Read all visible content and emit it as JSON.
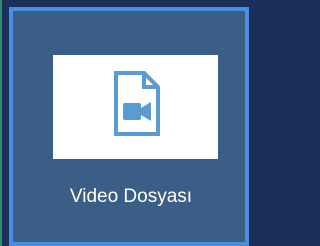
{
  "tile": {
    "label": "Video Dosyası",
    "icon": "video-file-icon"
  },
  "colors": {
    "background": "#1b2f5a",
    "tile": "#3b5e86",
    "tile_border": "#4a8ee2",
    "preview": "#ffffff",
    "icon": "#5a9bd1",
    "label": "#ffffff"
  }
}
